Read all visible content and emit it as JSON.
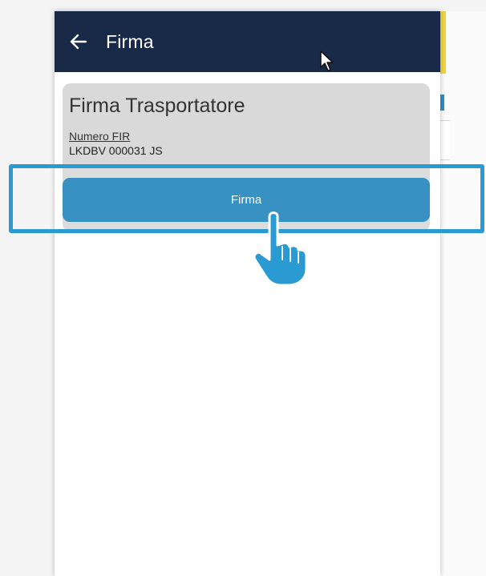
{
  "appbar": {
    "back_icon": "arrow-left-icon",
    "title": "Firma"
  },
  "card": {
    "title": "Firma Trasportatore",
    "fir_label": "Numero FIR",
    "fir_value": "LKDBV 000031 JS"
  },
  "actions": {
    "sign_label": "Firma"
  },
  "overlay": {
    "pointer_icon": "hand-pointer-icon",
    "cursor_icon": "mouse-cursor-icon",
    "accent": "#2a9ad3"
  },
  "colors": {
    "appbar": "#182a47",
    "card": "#d9d9d9",
    "button": "#2688be"
  }
}
